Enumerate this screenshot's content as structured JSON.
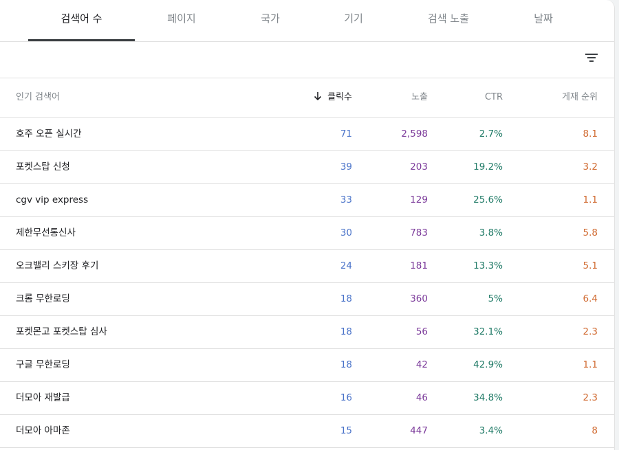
{
  "tabs": [
    {
      "label": "검색어 수",
      "active": true
    },
    {
      "label": "페이지",
      "active": false
    },
    {
      "label": "국가",
      "active": false
    },
    {
      "label": "기기",
      "active": false
    },
    {
      "label": "검색 노출",
      "active": false
    },
    {
      "label": "날짜",
      "active": false
    }
  ],
  "toolbar": {
    "filter_icon": "filter-icon"
  },
  "table": {
    "headers": {
      "query": "인기 검색어",
      "clicks": "클릭수",
      "impressions": "노출",
      "ctr": "CTR",
      "position": "게재 순위"
    },
    "sort_icon": "arrow-down-icon",
    "rows": [
      {
        "query": "호주 오픈 실시간",
        "clicks": "71",
        "impressions": "2,598",
        "ctr": "2.7%",
        "position": "8.1"
      },
      {
        "query": "포켓스탑 신청",
        "clicks": "39",
        "impressions": "203",
        "ctr": "19.2%",
        "position": "3.2"
      },
      {
        "query": "cgv vip express",
        "clicks": "33",
        "impressions": "129",
        "ctr": "25.6%",
        "position": "1.1"
      },
      {
        "query": "제한무선통신사",
        "clicks": "30",
        "impressions": "783",
        "ctr": "3.8%",
        "position": "5.8"
      },
      {
        "query": "오크밸리 스키장 후기",
        "clicks": "24",
        "impressions": "181",
        "ctr": "13.3%",
        "position": "5.1"
      },
      {
        "query": "크롬 무한로딩",
        "clicks": "18",
        "impressions": "360",
        "ctr": "5%",
        "position": "6.4"
      },
      {
        "query": "포켓몬고 포켓스탑 심사",
        "clicks": "18",
        "impressions": "56",
        "ctr": "32.1%",
        "position": "2.3"
      },
      {
        "query": "구글 무한로딩",
        "clicks": "18",
        "impressions": "42",
        "ctr": "42.9%",
        "position": "1.1"
      },
      {
        "query": "더모아 재발급",
        "clicks": "16",
        "impressions": "46",
        "ctr": "34.8%",
        "position": "2.3"
      },
      {
        "query": "더모아 아마존",
        "clicks": "15",
        "impressions": "447",
        "ctr": "3.4%",
        "position": "8"
      }
    ]
  },
  "colors": {
    "clicks": "#4a73c9",
    "impressions": "#7b3a9a",
    "ctr": "#1f7a66",
    "position": "#d0692f"
  }
}
